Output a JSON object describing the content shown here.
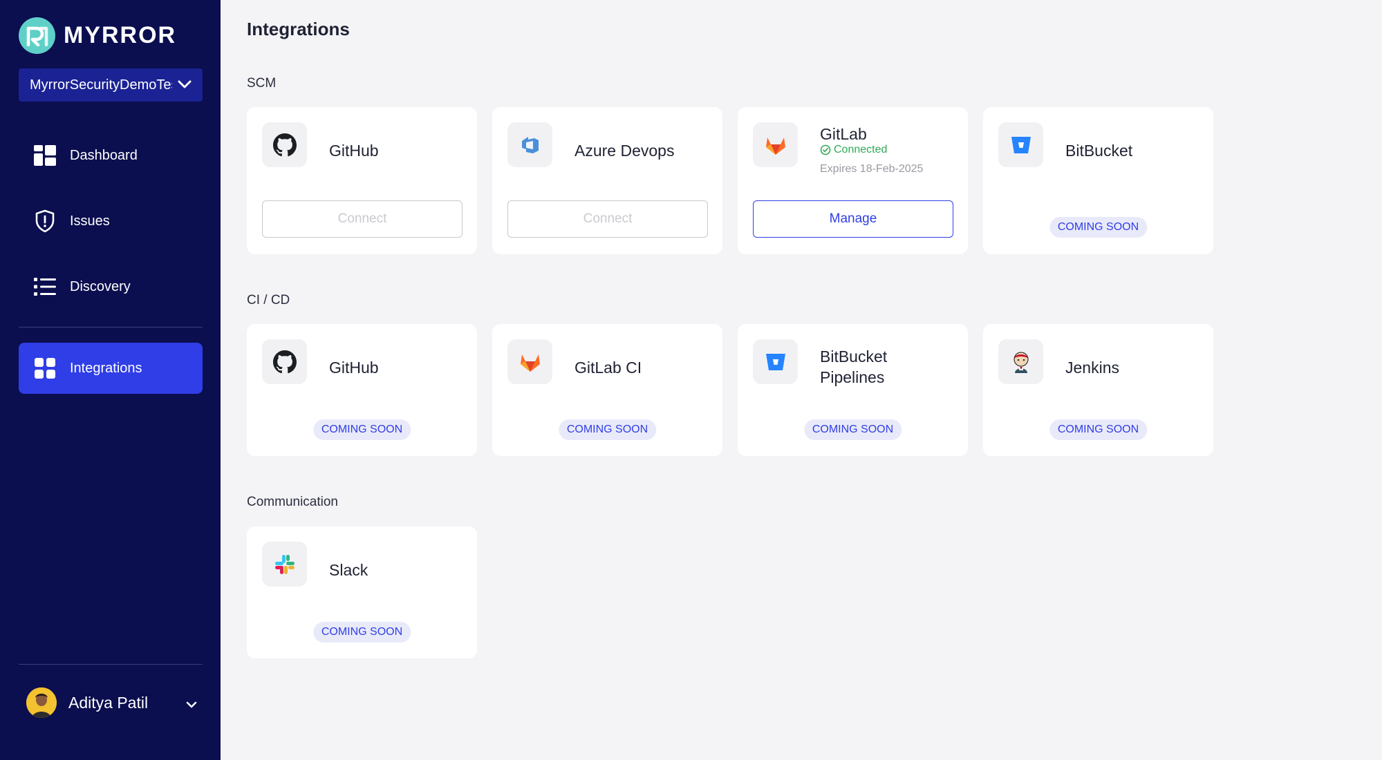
{
  "brand": {
    "name": "MYRROR",
    "logo_letter": "R"
  },
  "org_selector": {
    "value": "MyrrorSecurityDemoTest"
  },
  "sidebar": {
    "items": [
      {
        "label": "Dashboard",
        "icon": "dashboard-icon"
      },
      {
        "label": "Issues",
        "icon": "shield-icon"
      },
      {
        "label": "Discovery",
        "icon": "list-icon"
      },
      {
        "label": "Integrations",
        "icon": "grid-icon",
        "active": true
      }
    ]
  },
  "user": {
    "name": "Aditya Patil"
  },
  "page": {
    "title": "Integrations"
  },
  "sections": {
    "scm": {
      "title": "SCM",
      "cards": [
        {
          "name": "GitHub",
          "icon": "github-icon",
          "button": "Connect"
        },
        {
          "name": "Azure Devops",
          "icon": "azure-devops-icon",
          "button": "Connect"
        },
        {
          "name": "GitLab",
          "icon": "gitlab-icon",
          "status": "Connected",
          "expires": "Expires 18-Feb-2025",
          "button": "Manage"
        },
        {
          "name": "BitBucket",
          "icon": "bitbucket-icon",
          "badge": "COMING SOON"
        }
      ]
    },
    "cicd": {
      "title": "CI / CD",
      "cards": [
        {
          "name": "GitHub",
          "icon": "github-icon",
          "badge": "COMING SOON"
        },
        {
          "name": "GitLab CI",
          "icon": "gitlab-icon",
          "badge": "COMING SOON"
        },
        {
          "name_line1": "BitBucket",
          "name_line2": "Pipelines",
          "icon": "bitbucket-icon",
          "badge": "COMING SOON"
        },
        {
          "name": "Jenkins",
          "icon": "jenkins-icon",
          "badge": "COMING SOON"
        }
      ]
    },
    "communication": {
      "title": "Communication",
      "cards": [
        {
          "name": "Slack",
          "icon": "slack-icon",
          "badge": "COMING SOON"
        }
      ]
    }
  },
  "colors": {
    "sidebar_bg": "#0b0e4f",
    "accent": "#2f3ee6",
    "page_bg": "#f4f4f7",
    "success": "#2faa55",
    "badge_bg": "#e9eaf9"
  }
}
